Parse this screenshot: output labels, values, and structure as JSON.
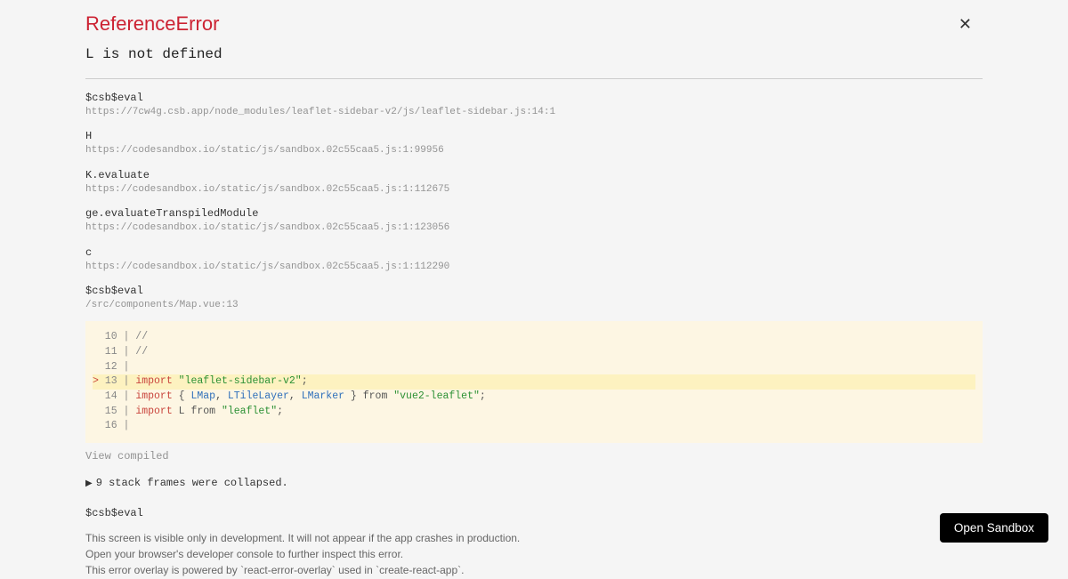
{
  "error": {
    "title": "ReferenceError",
    "message": "L is not defined"
  },
  "frames": [
    {
      "name": "$csb$eval",
      "loc": "https://7cw4g.csb.app/node_modules/leaflet-sidebar-v2/js/leaflet-sidebar.js:14:1"
    },
    {
      "name": "H",
      "loc": "https://codesandbox.io/static/js/sandbox.02c55caa5.js:1:99956"
    },
    {
      "name": "K.evaluate",
      "loc": "https://codesandbox.io/static/js/sandbox.02c55caa5.js:1:112675"
    },
    {
      "name": "ge.evaluateTranspiledModule",
      "loc": "https://codesandbox.io/static/js/sandbox.02c55caa5.js:1:123056"
    },
    {
      "name": "c",
      "loc": "https://codesandbox.io/static/js/sandbox.02c55caa5.js:1:112290"
    },
    {
      "name": "$csb$eval",
      "loc": "/src/components/Map.vue:13"
    }
  ],
  "code": {
    "l10": "  10 | //",
    "l11": "  11 | //",
    "l12": "  12 | ",
    "l13_caret": "> ",
    "l13_gutter": "13 | ",
    "l13_import": "import",
    "l13_q1": " \"",
    "l13_str": "leaflet-sidebar-v2",
    "l13_q2": "\"",
    "l13_semi": ";",
    "l14_gutter": "  14 | ",
    "l14_import": "import",
    "l14_brace1": " { ",
    "l14_a": "LMap",
    "l14_c1": ", ",
    "l14_b": "LTileLayer",
    "l14_c2": ", ",
    "l14_c": "LMarker",
    "l14_brace2": " } ",
    "l14_from": "from ",
    "l14_q1": "\"",
    "l14_str": "vue2-leaflet",
    "l14_q2": "\"",
    "l14_semi": ";",
    "l15_gutter": "  15 | ",
    "l15_import": "import",
    "l15_L": " L ",
    "l15_from": "from ",
    "l15_q1": "\"",
    "l15_str": "leaflet",
    "l15_q2": "\"",
    "l15_semi": ";",
    "l16": "  16 | "
  },
  "viewCompiled": "View compiled",
  "collapsed": {
    "tri": "▶",
    "text": "9 stack frames were collapsed."
  },
  "tailFrame": {
    "name": "$csb$eval"
  },
  "notes": {
    "l1": "This screen is visible only in development. It will not appear if the app crashes in production.",
    "l2": "Open your browser's developer console to further inspect this error.",
    "l3": "This error overlay is powered by `react-error-overlay` used in `create-react-app`."
  },
  "openSandbox": "Open Sandbox"
}
